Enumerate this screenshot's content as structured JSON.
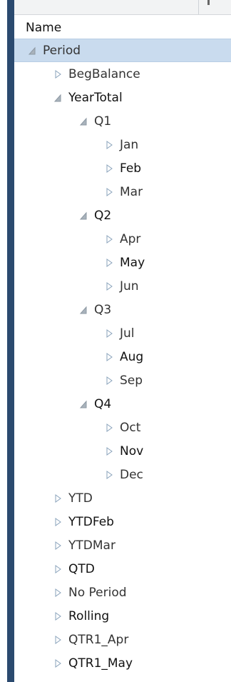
{
  "column_header": "Name",
  "rows": [
    {
      "label": "Period",
      "state": "expanded",
      "selected": true,
      "tone": "mid"
    },
    {
      "label": "BegBalance",
      "state": "collapsed",
      "tone": "mid"
    },
    {
      "label": "YearTotal",
      "state": "expanded",
      "tone": "dark"
    },
    {
      "label": "Q1",
      "state": "expanded",
      "tone": "mid"
    },
    {
      "label": "Jan",
      "state": "collapsed",
      "tone": "mid"
    },
    {
      "label": "Feb",
      "state": "collapsed",
      "tone": "dark"
    },
    {
      "label": "Mar",
      "state": "collapsed",
      "tone": "mid"
    },
    {
      "label": "Q2",
      "state": "expanded",
      "tone": "dark"
    },
    {
      "label": "Apr",
      "state": "collapsed",
      "tone": "mid"
    },
    {
      "label": "May",
      "state": "collapsed",
      "tone": "dark"
    },
    {
      "label": "Jun",
      "state": "collapsed",
      "tone": "mid"
    },
    {
      "label": "Q3",
      "state": "expanded",
      "tone": "mid"
    },
    {
      "label": "Jul",
      "state": "collapsed",
      "tone": "mid"
    },
    {
      "label": "Aug",
      "state": "collapsed",
      "tone": "dark"
    },
    {
      "label": "Sep",
      "state": "collapsed",
      "tone": "mid"
    },
    {
      "label": "Q4",
      "state": "expanded",
      "tone": "dark"
    },
    {
      "label": "Oct",
      "state": "collapsed",
      "tone": "mid"
    },
    {
      "label": "Nov",
      "state": "collapsed",
      "tone": "dark"
    },
    {
      "label": "Dec",
      "state": "collapsed",
      "tone": "mid"
    },
    {
      "label": "YTD",
      "state": "collapsed",
      "tone": "mid"
    },
    {
      "label": "YTDFeb",
      "state": "collapsed",
      "tone": "dark"
    },
    {
      "label": "YTDMar",
      "state": "collapsed",
      "tone": "mid"
    },
    {
      "label": "QTD",
      "state": "collapsed",
      "tone": "dark"
    },
    {
      "label": "No Period",
      "state": "collapsed",
      "tone": "mid"
    },
    {
      "label": "Rolling",
      "state": "collapsed",
      "tone": "dark"
    },
    {
      "label": "QTR1_Apr",
      "state": "collapsed",
      "tone": "mid"
    },
    {
      "label": "QTR1_May",
      "state": "collapsed",
      "tone": "dark"
    }
  ]
}
